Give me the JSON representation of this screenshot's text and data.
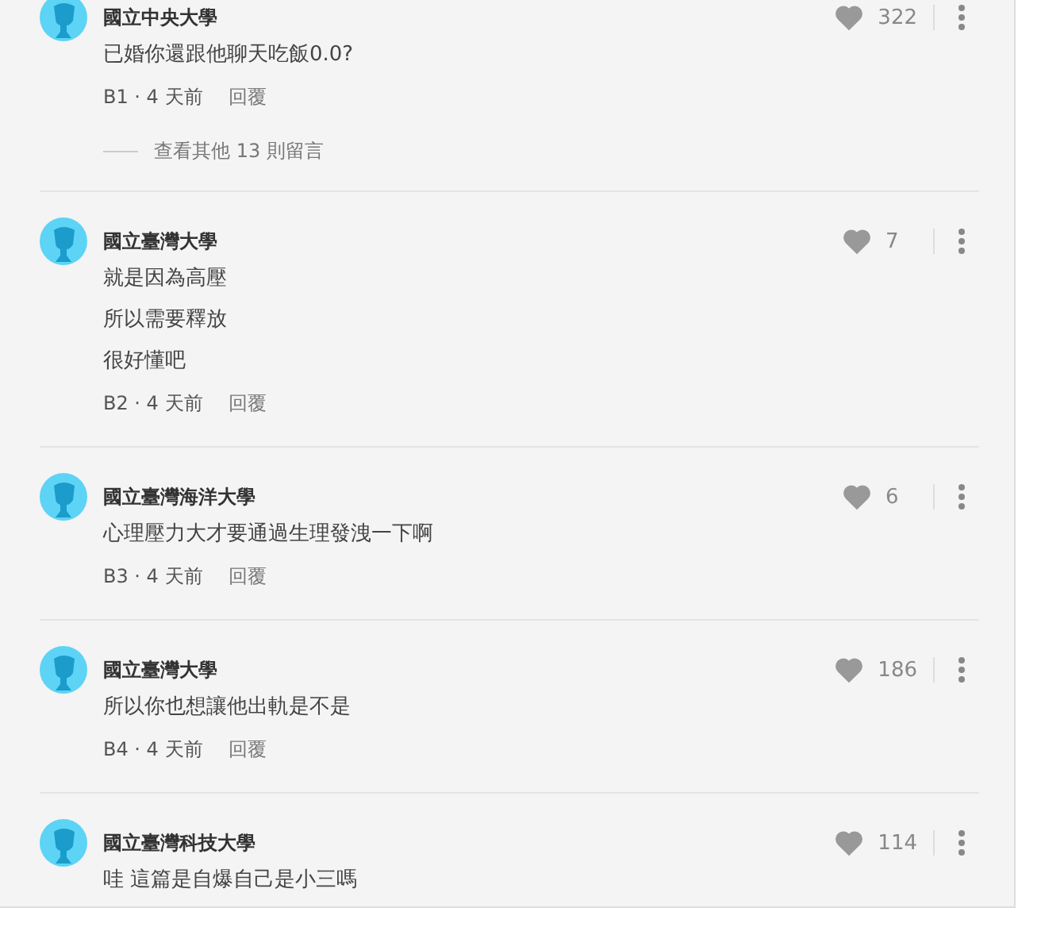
{
  "comments": [
    {
      "author": "國立中央大學",
      "lines": [
        "已婚你還跟他聊天吃飯0.0?"
      ],
      "meta": "B1 · 4 天前",
      "reply": "回覆",
      "likes": "322",
      "more_replies": "查看其他 13 則留言"
    },
    {
      "author": "國立臺灣大學",
      "lines": [
        "就是因為高壓",
        "所以需要釋放",
        "很好懂吧"
      ],
      "meta": "B2 · 4 天前",
      "reply": "回覆",
      "likes": "7"
    },
    {
      "author": "國立臺灣海洋大學",
      "lines": [
        "心理壓力大才要通過生理發洩一下啊"
      ],
      "meta": "B3 · 4 天前",
      "reply": "回覆",
      "likes": "6"
    },
    {
      "author": "國立臺灣大學",
      "lines": [
        "所以你也想讓他出軌是不是"
      ],
      "meta": "B4 · 4 天前",
      "reply": "回覆",
      "likes": "186"
    },
    {
      "author": "國立臺灣科技大學",
      "lines": [
        "哇 這篇是自爆自己是小三嗎"
      ],
      "likes": "114"
    }
  ]
}
